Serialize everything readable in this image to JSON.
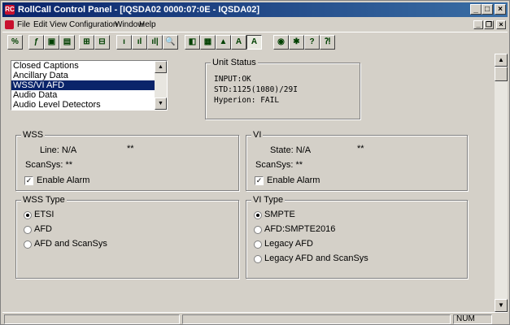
{
  "window": {
    "title": "RollCall Control Panel - [IQSDA02 0000:07:0E - IQSDA02]",
    "app_icon": "RC"
  },
  "title_buttons": {
    "minimize": "_",
    "maximize": "□",
    "close": "×"
  },
  "menu": {
    "items": [
      "File",
      "Edit",
      "View",
      "Configuration",
      "Window",
      "Help"
    ]
  },
  "mdi_buttons": {
    "minimize": "_",
    "restore": "❐",
    "close": "×"
  },
  "toolbar": {
    "buttons": [
      "%",
      "ƒ",
      "▣",
      "▤",
      "⊞",
      "⊟",
      "ı",
      "ıl",
      "ıl|",
      "🔍",
      "◧",
      "▦",
      "▲",
      "A",
      "A",
      "◉",
      "✱",
      "?",
      "⁈"
    ]
  },
  "list": {
    "items": [
      "Closed Captions",
      "Ancillary Data",
      "WSS/VI AFD",
      "Audio Data",
      "Audio Level Detectors"
    ],
    "selected_index": 2
  },
  "unit_status": {
    "title": "Unit Status",
    "lines": [
      "INPUT:OK",
      "STD:1125(1080)/29I",
      "Hyperion: FAIL"
    ]
  },
  "wss": {
    "title": "WSS",
    "line_label": "Line: N/A",
    "line_value": "**",
    "scansys_label": "ScanSys: **",
    "enable_alarm": "Enable Alarm",
    "enable_alarm_checked": true
  },
  "vi": {
    "title": "VI",
    "state_label": "State: N/A",
    "state_value": "**",
    "scansys_label": "ScanSys: **",
    "enable_alarm": "Enable Alarm",
    "enable_alarm_checked": true
  },
  "wss_type": {
    "title": "WSS Type",
    "options": [
      "ETSI",
      "AFD",
      "AFD and ScanSys"
    ],
    "selected_index": 0
  },
  "vi_type": {
    "title": "VI Type",
    "options": [
      "SMPTE",
      "AFD:SMPTE2016",
      "Legacy AFD",
      "Legacy AFD and ScanSys"
    ],
    "selected_index": 0
  },
  "statusbar": {
    "num": "NUM"
  },
  "glyphs": {
    "check": "✓",
    "up": "▲",
    "down": "▼"
  }
}
